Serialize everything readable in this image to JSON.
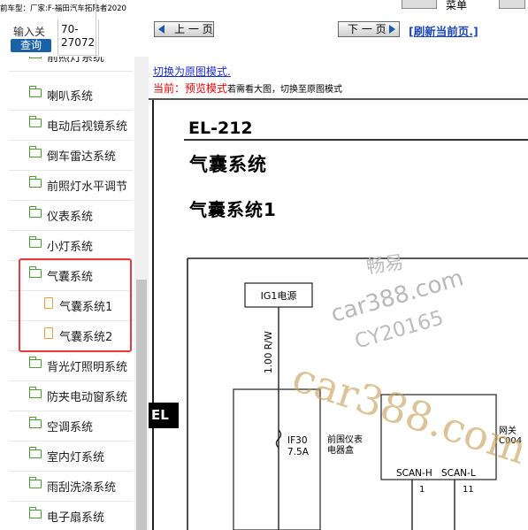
{
  "left_panel": {
    "car_title": "前车型：厂家:F-福田汽车拓陆者2020",
    "input_label": "输入关",
    "query_button": "查询",
    "code_lines": [
      "70-",
      "27072"
    ],
    "tree_items": [
      {
        "label": "前照灯系统",
        "type": "folder"
      },
      {
        "label": "喇叭系统",
        "type": "folder"
      },
      {
        "label": "电动后视镜系统",
        "type": "folder"
      },
      {
        "label": "倒车雷达系统",
        "type": "folder"
      },
      {
        "label": "前照灯水平调节",
        "type": "folder"
      },
      {
        "label": "仪表系统",
        "type": "folder"
      },
      {
        "label": "小灯系统",
        "type": "folder"
      },
      {
        "label": "气囊系统",
        "type": "folder-open"
      },
      {
        "label": "气囊系统1",
        "type": "document"
      },
      {
        "label": "气囊系统2",
        "type": "document"
      },
      {
        "label": "背光灯照明系统",
        "type": "folder"
      },
      {
        "label": "防夹电动窗系统",
        "type": "folder"
      },
      {
        "label": "空调系统",
        "type": "folder"
      },
      {
        "label": "室内灯系统",
        "type": "folder"
      },
      {
        "label": "雨刮洗涤系统",
        "type": "folder"
      },
      {
        "label": "电子扇系统",
        "type": "folder"
      }
    ]
  },
  "toolbar": {
    "menu_label": "菜单",
    "prev_label": "上 一 页",
    "next_label": "下 一 页",
    "refresh_label": "[刷新当前页.]"
  },
  "viewer": {
    "switch_link": "切换为原图模式.",
    "status_prefix": "当前：预览模式",
    "status_suffix": "若需看大图，切换至原图模式"
  },
  "document": {
    "code": "EL-212",
    "title": "气囊系统",
    "subtitle": "气囊系统1",
    "tab_label": "EL",
    "diagram": {
      "power_label": "IG1电源",
      "wire_label": "1.00 R/W",
      "fuse_label": "IF30",
      "fuse_rating": "7.5A",
      "box_label_line1": "前围仪表",
      "box_label_line2": "电器盒",
      "gateway_line1": "网关",
      "gateway_line2": "C004",
      "pin_left": "SCAN-H",
      "pin_right": "SCAN-L",
      "pin_left_no": "1",
      "pin_right_no": "11"
    }
  },
  "watermarks": {
    "w1": "畅易",
    "w2": "car388.com",
    "w3": "CY20165",
    "w4": "car388.com"
  },
  "colors": {
    "query_button": "#1a62a8",
    "highlight_border": "#e83a3a",
    "folder_icon": "#4f9b32",
    "document_icon": "#e7a23c",
    "link": "#1d46b5",
    "status_red": "#e00000",
    "watermark_gold": "#c8a15a",
    "watermark_gray": "#b9b9b9"
  }
}
